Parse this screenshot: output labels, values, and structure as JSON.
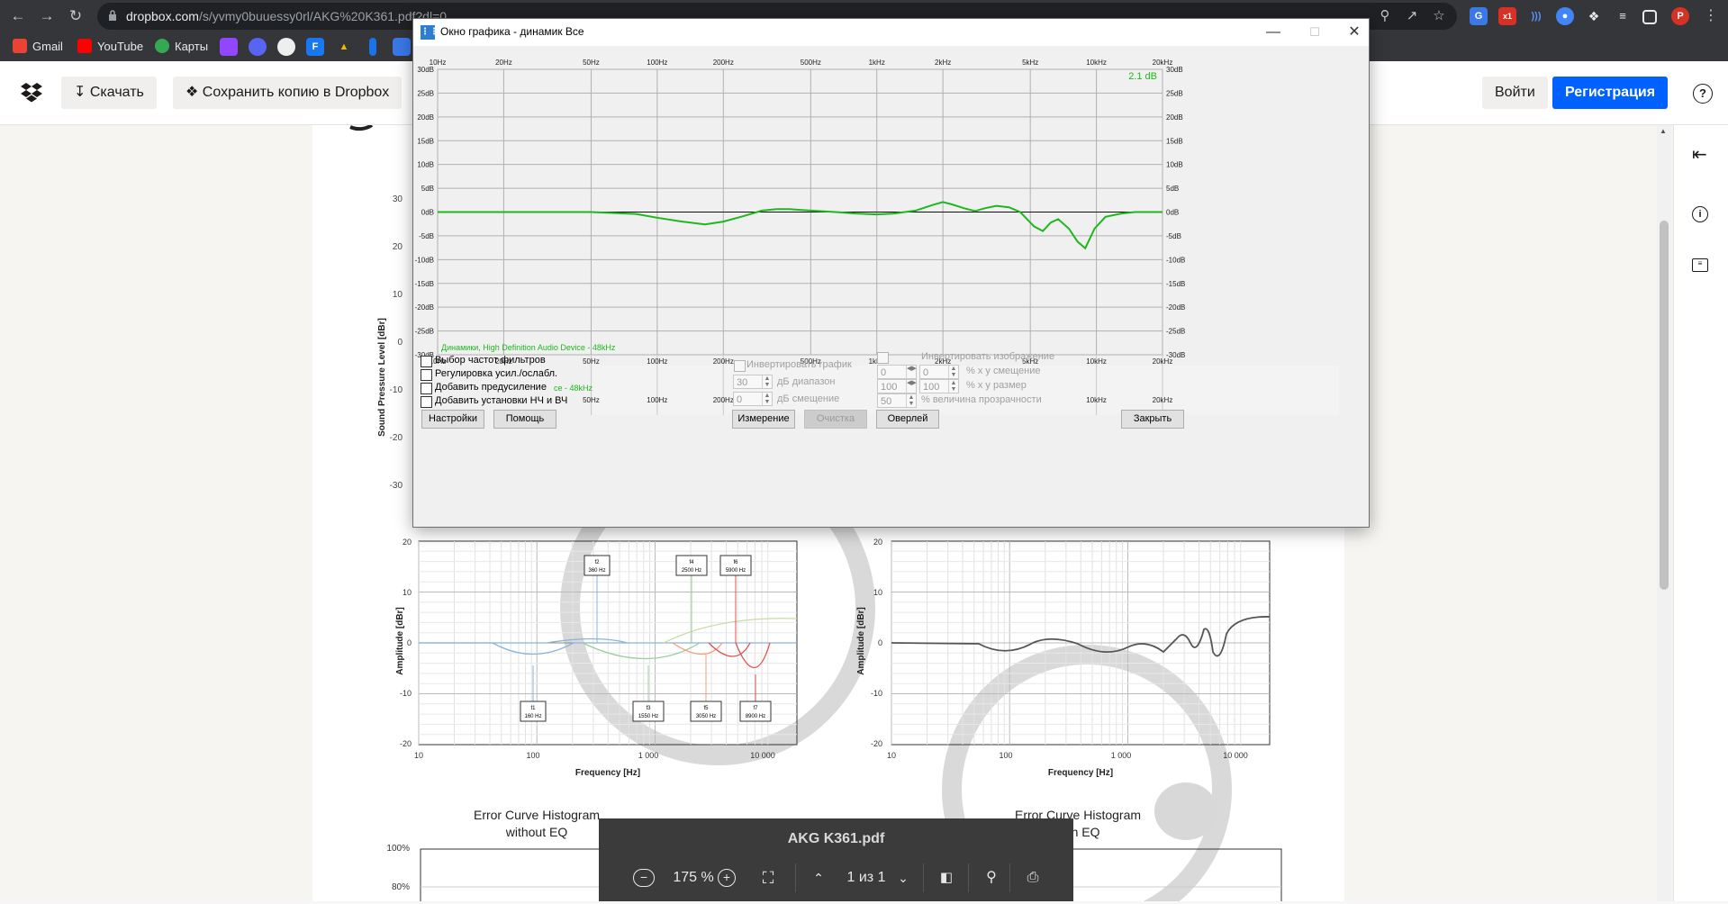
{
  "browser": {
    "url_host": "dropbox.com",
    "url_path": "/s/yvmy0buuessy0rl/AKG%20K361.pdf?dl=0",
    "bookmarks": [
      "Gmail",
      "YouTube",
      "Карты"
    ],
    "profile_initial": "P"
  },
  "dropbox": {
    "download_label": "Скачать",
    "save_copy_label": "Сохранить копию в Dropbox",
    "login_label": "Войти",
    "signup_label": "Регистрация",
    "help_icon_label": "?"
  },
  "pdf_toolbar": {
    "file_name": "AKG K361.pdf",
    "zoom": "175 %",
    "page_indicator": "1 из 1"
  },
  "document": {
    "error_hist_left": [
      "Error Curve Histogram",
      "without EQ"
    ],
    "error_hist_right": [
      "Error Curve Histogram",
      "with EQ"
    ],
    "hist_y_ticks": [
      "100%",
      "80%"
    ],
    "charts_y_ticks": [
      "20",
      "10",
      "0",
      "-10",
      "-20"
    ],
    "charts_x_ticks": [
      "10",
      "100",
      "1 000",
      "10 000"
    ],
    "charts_x_label": "Frequency [Hz]",
    "charts_y_label": "Amplitude [dBr]",
    "top_y_label": "Sound Pressure Level [dBr]",
    "top_y_ticks": [
      "30",
      "20",
      "10",
      "0",
      "-10",
      "-20",
      "-30"
    ],
    "filter_boxes_top": [
      {
        "name": "f2",
        "freq": "360 Hz"
      },
      {
        "name": "f4",
        "freq": "2500 Hz"
      },
      {
        "name": "f6",
        "freq": "5900 Hz"
      }
    ],
    "filter_boxes_bottom": [
      {
        "name": "f1",
        "freq": "160 Hz"
      },
      {
        "name": "f3",
        "freq": "1550 Hz"
      },
      {
        "name": "f5",
        "freq": "3050 Hz"
      },
      {
        "name": "f7",
        "freq": "8900 Hz"
      }
    ]
  },
  "graph_window": {
    "title": "Окно графика - динамик Все",
    "current_db": "2.1 dB",
    "legend": "Динамики, High Definition Audio Device - 48kHz",
    "legend_partial": "ce - 48kHz",
    "checkboxes": [
      {
        "label": "Выбор частот фильтров",
        "checked": false
      },
      {
        "label": "Регулировка усил./ослабл.",
        "checked": false
      },
      {
        "label": "Добавить предусиление",
        "checked": false
      },
      {
        "label": "Добавить установки НЧ и ВЧ",
        "checked": false
      }
    ],
    "invert_graph_label": "Инвертировать график",
    "db_range_value": "30",
    "db_range_label": "дБ диапазон",
    "db_offset_value": "0",
    "db_offset_label": "дБ смещение",
    "invert_image_label": "Инвертировать изображение",
    "offset_x": "0",
    "offset_y": "0",
    "offset_label": "% x y смещение",
    "size_x": "100",
    "size_y": "100",
    "size_label": "% x y размер",
    "opacity_value": "50",
    "opacity_label": "% величина прозрачности",
    "buttons": {
      "settings": "Настройки",
      "help": "Помощь",
      "measure": "Измерение",
      "clear": "Очистка",
      "overlay": "Оверлей",
      "close": "Закрыть"
    },
    "freq_ticks": [
      "10Hz",
      "20Hz",
      "50Hz",
      "100Hz",
      "200Hz",
      "500Hz",
      "1kHz",
      "2kHz",
      "5kHz",
      "10kHz",
      "20kHz"
    ],
    "db_ticks": [
      "30dB",
      "25dB",
      "20dB",
      "15dB",
      "10dB",
      "5dB",
      "0dB",
      "-5dB",
      "-10dB",
      "-15dB",
      "-20dB",
      "-25dB",
      "-30dB"
    ],
    "curve_color": "#1db81d"
  },
  "chart_data": {
    "type": "line",
    "title": "",
    "xlabel": "",
    "ylabel": "",
    "x_scale": "log",
    "xlim": [
      10,
      20000
    ],
    "ylim": [
      -30,
      30
    ],
    "grid": true,
    "series": [
      {
        "name": "Динамики, High Definition Audio Device - 48kHz",
        "x": [
          10,
          50,
          80,
          100,
          130,
          165,
          200,
          250,
          300,
          350,
          400,
          500,
          650,
          800,
          1000,
          1200,
          1500,
          1800,
          2000,
          2200,
          2500,
          2800,
          3100,
          3500,
          4000,
          4500,
          5200,
          5700,
          6200,
          6700,
          7500,
          8200,
          8900,
          9800,
          11000,
          13000,
          15000,
          20000
        ],
        "y": [
          0,
          0,
          -0.4,
          -1.2,
          -2.0,
          -2.6,
          -2.0,
          -0.8,
          0.3,
          0.6,
          0.6,
          0.3,
          0,
          -0.3,
          -0.5,
          -0.3,
          0.3,
          1.5,
          2.1,
          1.6,
          0.8,
          0.2,
          0.8,
          1.3,
          1.0,
          0,
          -3.0,
          -4.0,
          -2.2,
          -1.5,
          -3.5,
          -6.2,
          -7.6,
          -3.5,
          -1.0,
          -0.3,
          0,
          0
        ]
      }
    ]
  }
}
